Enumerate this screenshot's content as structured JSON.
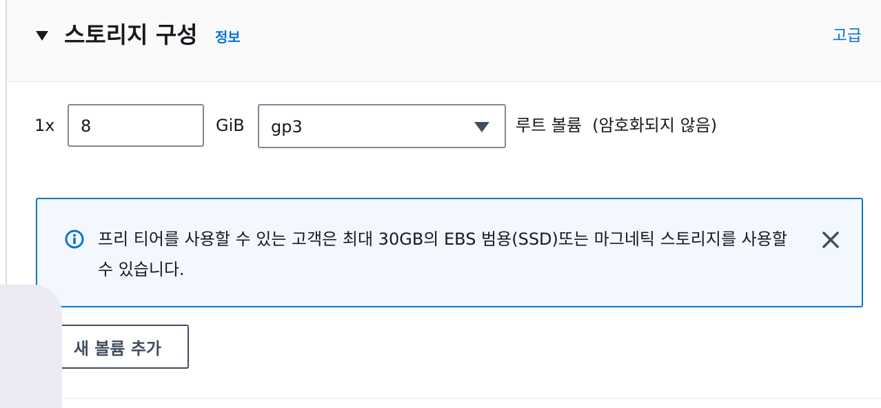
{
  "section": {
    "title": "스토리지 구성",
    "info_link": "정보",
    "advanced_link": "고급"
  },
  "volume": {
    "count_label": "1x",
    "size_value": "8",
    "unit_label": "GiB",
    "type_value": "gp3",
    "description": "루트 볼륨  (암호화되지 않음)"
  },
  "alert": {
    "icon": "info-circle-icon",
    "message": "프리 티어를 사용할 수 있는 고객은 최대 30GB의 EBS 범용(SSD)또는 마그네틱 스토리지를 사용할 수 있습니다.",
    "close_icon": "close-icon"
  },
  "add_volume_button": "새 볼륨 추가",
  "colors": {
    "link": "#0972d3",
    "alert_border": "#0972d3",
    "alert_background": "#f2f8fd",
    "text": "#16191f"
  }
}
